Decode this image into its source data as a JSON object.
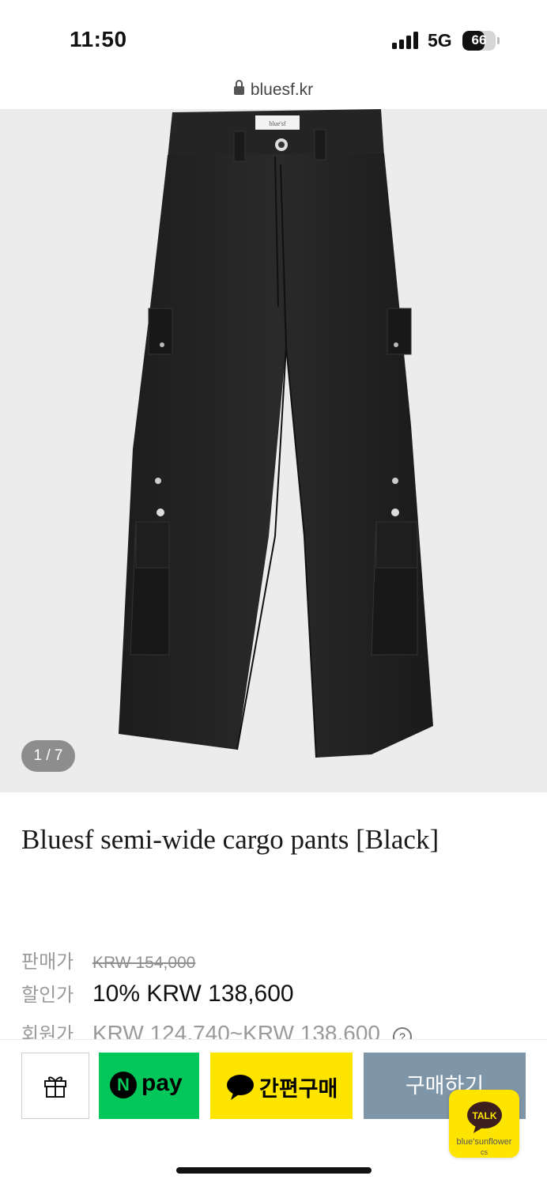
{
  "status_bar": {
    "time": "11:50",
    "network": "5G",
    "battery": "66",
    "battery_level": 0.66
  },
  "browser": {
    "url": "bluesf.kr"
  },
  "gallery": {
    "counter": "1 / 7",
    "brand_tag": "blue'sf"
  },
  "product": {
    "title": "Bluesf semi-wide cargo pants [Black]"
  },
  "prices": {
    "sale_label": "판매가",
    "sale_value": "KRW 154,000",
    "discount_label": "할인가",
    "discount_value": "10% KRW 138,600",
    "member_label": "회원가",
    "member_value": "KRW 124,740~KRW 138,600",
    "member_help": "?"
  },
  "buybar": {
    "npay_n": "N",
    "npay_label": "pay",
    "kakao_label": "간편구매",
    "buy_label": "구매하기"
  },
  "talk_widget": {
    "label": "TALK",
    "line1": "blue'sunflower",
    "line2": "cs"
  },
  "colors": {
    "npay": "#03c75a",
    "kakao": "#fee500",
    "buy": "#7f96a8"
  },
  "icons": {
    "gift": "gift-icon",
    "lock": "lock-icon",
    "help": "question-circle-icon"
  }
}
